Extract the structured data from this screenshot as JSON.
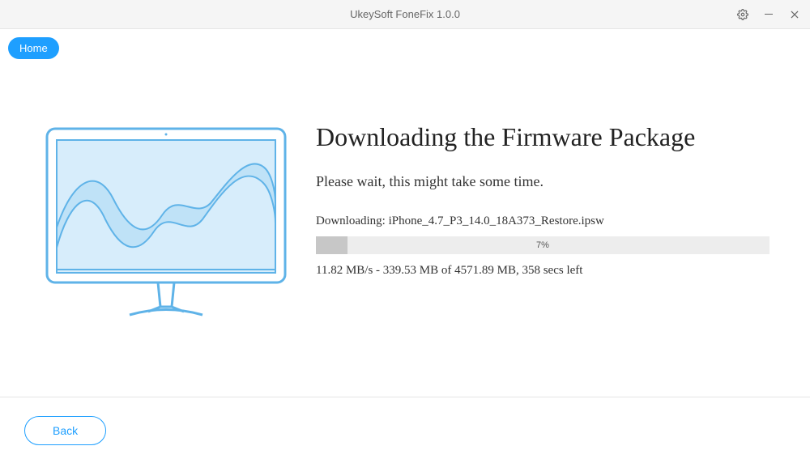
{
  "titlebar": {
    "title": "UkeySoft FoneFix 1.0.0"
  },
  "nav": {
    "home_label": "Home"
  },
  "main": {
    "heading": "Downloading the Firmware Package",
    "subheading": "Please wait, this might take some time.",
    "downloading_label": "Downloading: iPhone_4.7_P3_14.0_18A373_Restore.ipsw",
    "progress_percent": "7%",
    "progress_width": "7%",
    "stats_line": "11.82 MB/s - 339.53 MB of 4571.89 MB, 358 secs left"
  },
  "footer": {
    "back_label": "Back"
  }
}
